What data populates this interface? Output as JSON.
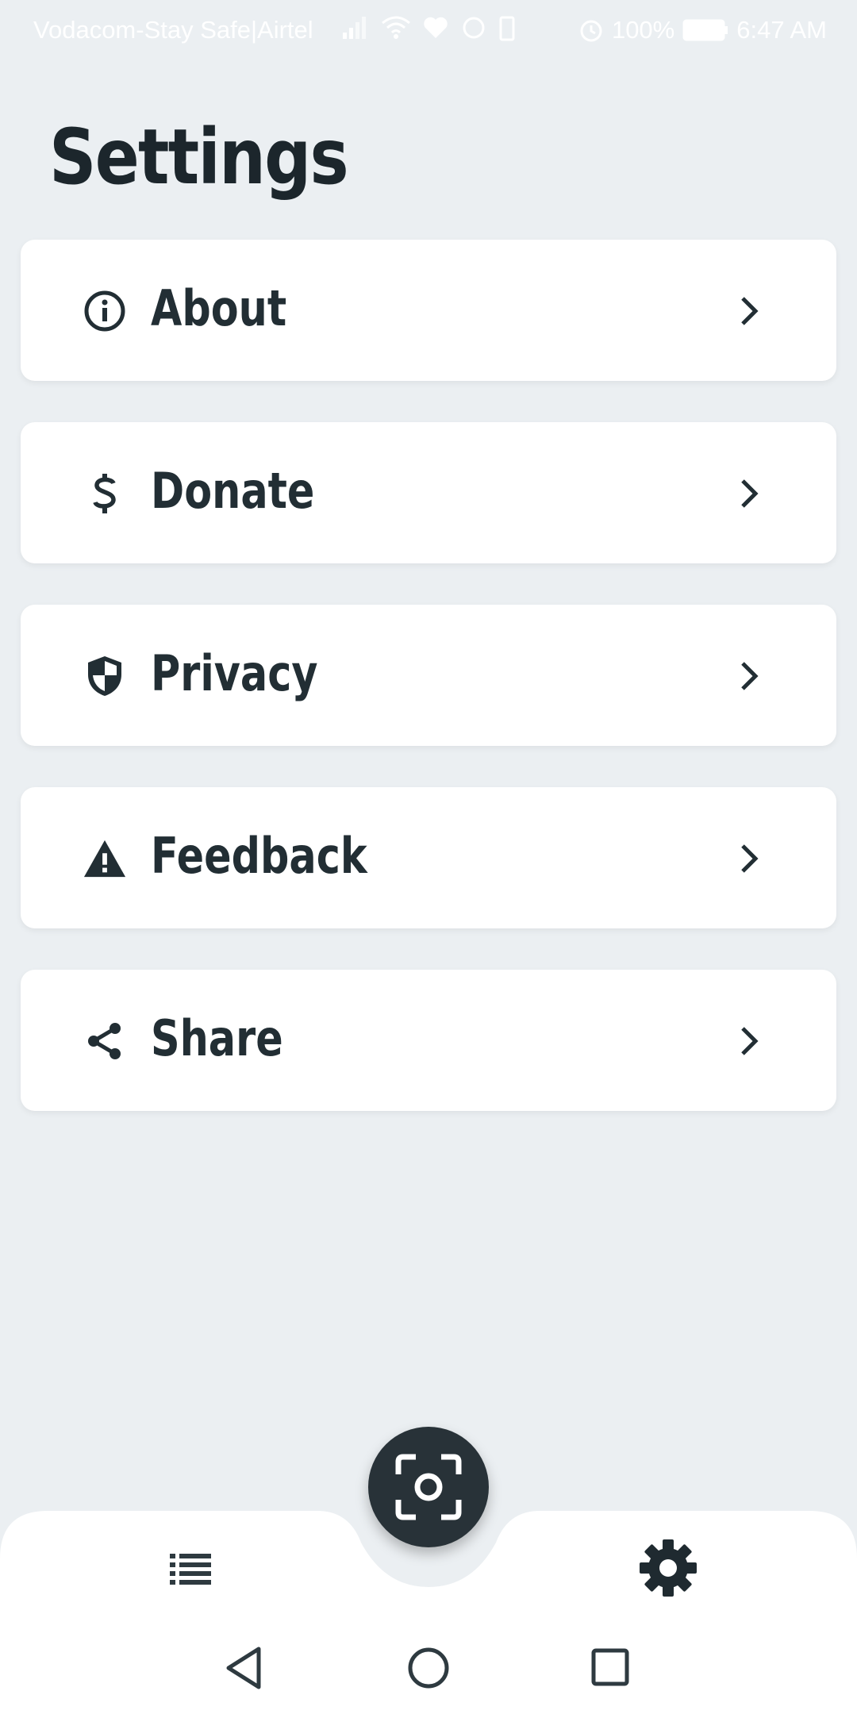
{
  "status_bar": {
    "carrier": "Vodacom-Stay Safe|Airtel",
    "battery": "100%",
    "time": "6:47 AM"
  },
  "page": {
    "title": "Settings"
  },
  "menu": {
    "items": [
      {
        "label": "About",
        "icon": "info-icon"
      },
      {
        "label": "Donate",
        "icon": "dollar-icon"
      },
      {
        "label": "Privacy",
        "icon": "shield-icon"
      },
      {
        "label": "Feedback",
        "icon": "warning-icon"
      },
      {
        "label": "Share",
        "icon": "share-icon"
      }
    ]
  },
  "bottom_nav": {
    "left": "list-icon",
    "center": "scan-icon",
    "right": "gear-icon"
  },
  "colors": {
    "background": "#ebeff2",
    "card": "#ffffff",
    "text": "#1f2a30",
    "fab": "#283238"
  }
}
